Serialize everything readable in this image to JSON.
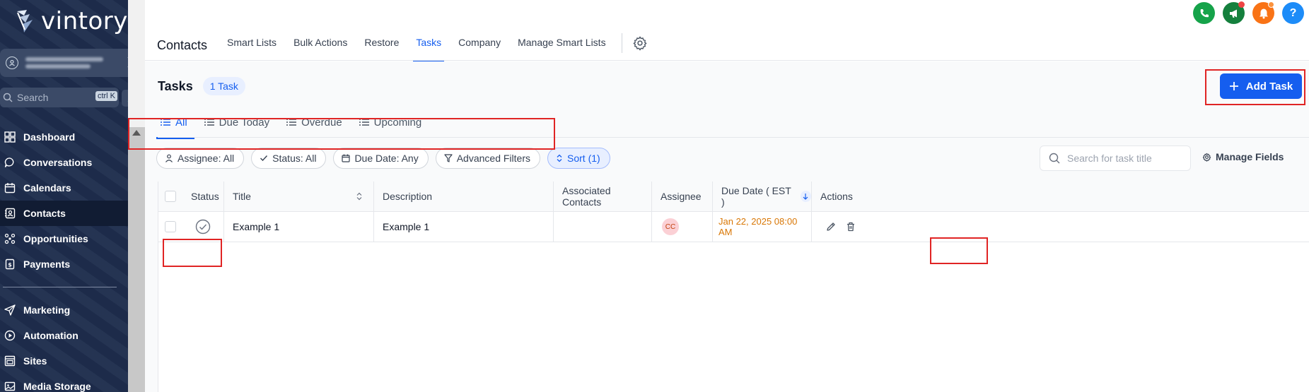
{
  "sidebar": {
    "logo_text": "vintory",
    "search_placeholder": "Search",
    "search_shortcut": "ctrl K",
    "items": [
      {
        "label": "Dashboard",
        "icon": "grid-icon"
      },
      {
        "label": "Conversations",
        "icon": "chat-icon"
      },
      {
        "label": "Calendars",
        "icon": "calendar-icon"
      },
      {
        "label": "Contacts",
        "icon": "contacts-icon",
        "active": true
      },
      {
        "label": "Opportunities",
        "icon": "opportunities-icon"
      },
      {
        "label": "Payments",
        "icon": "payments-icon"
      },
      {
        "label": "Marketing",
        "icon": "send-icon"
      },
      {
        "label": "Automation",
        "icon": "automation-icon"
      },
      {
        "label": "Sites",
        "icon": "sites-icon"
      },
      {
        "label": "Media Storage",
        "icon": "media-icon"
      }
    ]
  },
  "topbar": {
    "title": "Contacts",
    "tabs": [
      "Smart Lists",
      "Bulk Actions",
      "Restore",
      "Tasks",
      "Company",
      "Manage Smart Lists"
    ],
    "active_tab": "Tasks",
    "help_label": "?"
  },
  "tasks": {
    "title": "Tasks",
    "count_label": "1 Task",
    "add_label": "Add Task",
    "sub_tabs": [
      "All",
      "Due Today",
      "Overdue",
      "Upcoming"
    ],
    "filters": {
      "assignee": "Assignee: All",
      "status": "Status: All",
      "due_date": "Due Date: Any",
      "advanced": "Advanced Filters",
      "sort": "Sort (1)"
    },
    "search_placeholder": "Search for task title",
    "manage_fields": "Manage Fields"
  },
  "table": {
    "headers": {
      "status": "Status",
      "title": "Title",
      "description": "Description",
      "associated": "Associated Contacts",
      "assignee": "Assignee",
      "due": "Due Date ( EST )",
      "actions": "Actions"
    },
    "rows": [
      {
        "title": "Example 1",
        "description": "Example 1",
        "associated": "",
        "assignee_initials": "CC",
        "due": "Jan 22, 2025 08:00 AM"
      }
    ]
  },
  "colors": {
    "sidebar_bg": "#1e2d4d",
    "primary": "#155eef",
    "highlight_box": "#e02424",
    "due_text": "#d97706"
  }
}
